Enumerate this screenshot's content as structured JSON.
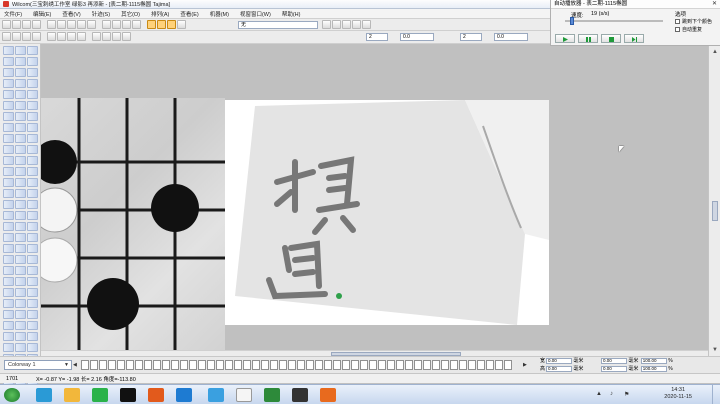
{
  "window": {
    "title": "Wilcom(三宝刺绣工作室  绿影3 再添新 - [表二期-1115椭圆          Tajima]"
  },
  "menu": [
    "文件(F)",
    "编辑(E)",
    "查看(V)",
    "针迹(S)",
    "其它(O)",
    "排列(A)",
    "查看(E)",
    "机器(M)",
    "视窗窗口(W)",
    "帮助(H)"
  ],
  "toolbar": {
    "stitch_type": "无",
    "field_a": "2",
    "field_b": "0.0",
    "field_c": "2",
    "field_d": "0.0"
  },
  "player": {
    "title": "自动播放器 - 表二期-1115椭圆",
    "speed_label": "速度:",
    "speed_value": "19 (s/s)",
    "speed_level": 0.05,
    "options_title": "选项",
    "opt_repeat": "跳到下个颜色",
    "opt_auto_repeat": "自动重复"
  },
  "bottom": {
    "colorway": "Colorway 1",
    "meas": {
      "w_label": "宽",
      "w_value": "0.00",
      "h_label": "高",
      "h_value": "0.00",
      "unit1": "毫米",
      "unit2": "毫米",
      "pct1": "100.00",
      "pct2": "100.00",
      "unit3": "毫米",
      "unit4": "毫米",
      "pct_unit": "%"
    }
  },
  "status": {
    "stitch_count": "1701",
    "coords": "X= -0.87 Y= -1.98 长=   2.16 角度=-113.80"
  },
  "taskbar": {
    "time": "14:31",
    "date": "2020-11-15"
  },
  "colors": {
    "accent": "#ffd27a",
    "tool_blue": "#c4d3ec"
  }
}
